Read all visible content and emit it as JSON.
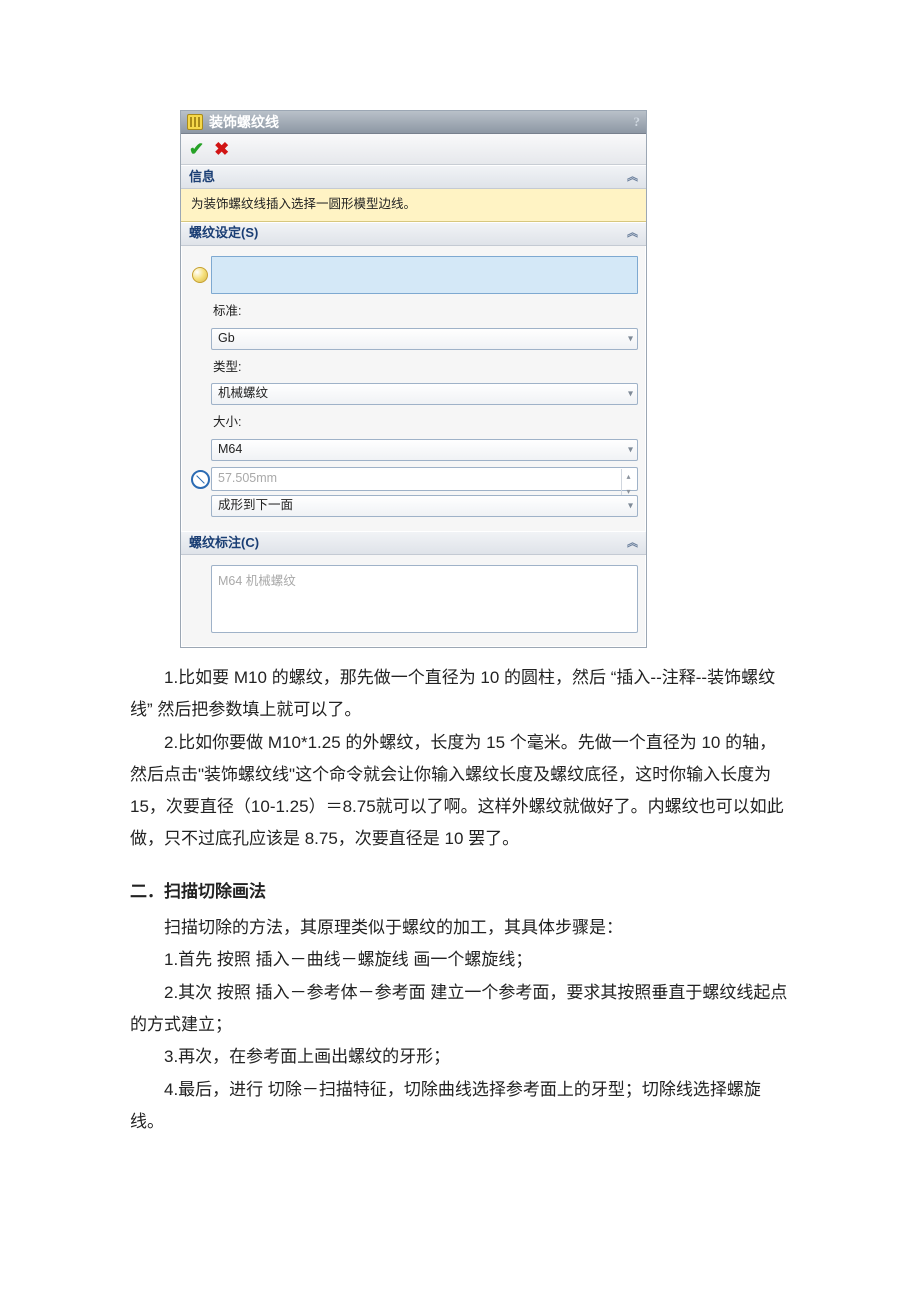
{
  "panel": {
    "title": "装饰螺纹线",
    "help": "?",
    "info_header": "信息",
    "info_note": "为装饰螺纹线插入选择一圆形模型边线。",
    "settings_header": "螺纹设定(S)",
    "labels": {
      "standard": "标准:",
      "type": "类型:",
      "size": "大小:"
    },
    "values": {
      "standard": "Gb",
      "type": "机械螺纹",
      "size": "M64",
      "diameter": "57.505mm",
      "endcond": "成形到下一面"
    },
    "note_header": "螺纹标注(C)",
    "note_value": "M64 机械螺纹"
  },
  "text": {
    "p1": "1.比如要 M10 的螺纹，那先做一个直径为 10 的圆柱，然后 “插入--注释--装饰螺纹线” 然后把参数填上就可以了。",
    "p2": "2.比如你要做 M10*1.25 的外螺纹，长度为 15 个毫米。先做一个直径为 10 的轴，然后点击\"装饰螺纹线\"这个命令就会让你输入螺纹长度及螺纹底径，这时你输入长度为 15，次要直径（10-1.25）＝8.75就可以了啊。这样外螺纹就做好了。内螺纹也可以如此做，只不过底孔应该是 8.75，次要直径是 10 罢了。",
    "h2": "二．扫描切除画法",
    "p3": "扫描切除的方法，其原理类似于螺纹的加工，其具体步骤是：",
    "p4": "1.首先 按照 插入－曲线－螺旋线 画一个螺旋线；",
    "p5": "2.其次 按照 插入－参考体－参考面 建立一个参考面，要求其按照垂直于螺纹线起点的方式建立；",
    "p6": "3.再次，在参考面上画出螺纹的牙形；",
    "p7": "4.最后，进行 切除－扫描特征，切除曲线选择参考面上的牙型；切除线选择螺旋线。"
  }
}
